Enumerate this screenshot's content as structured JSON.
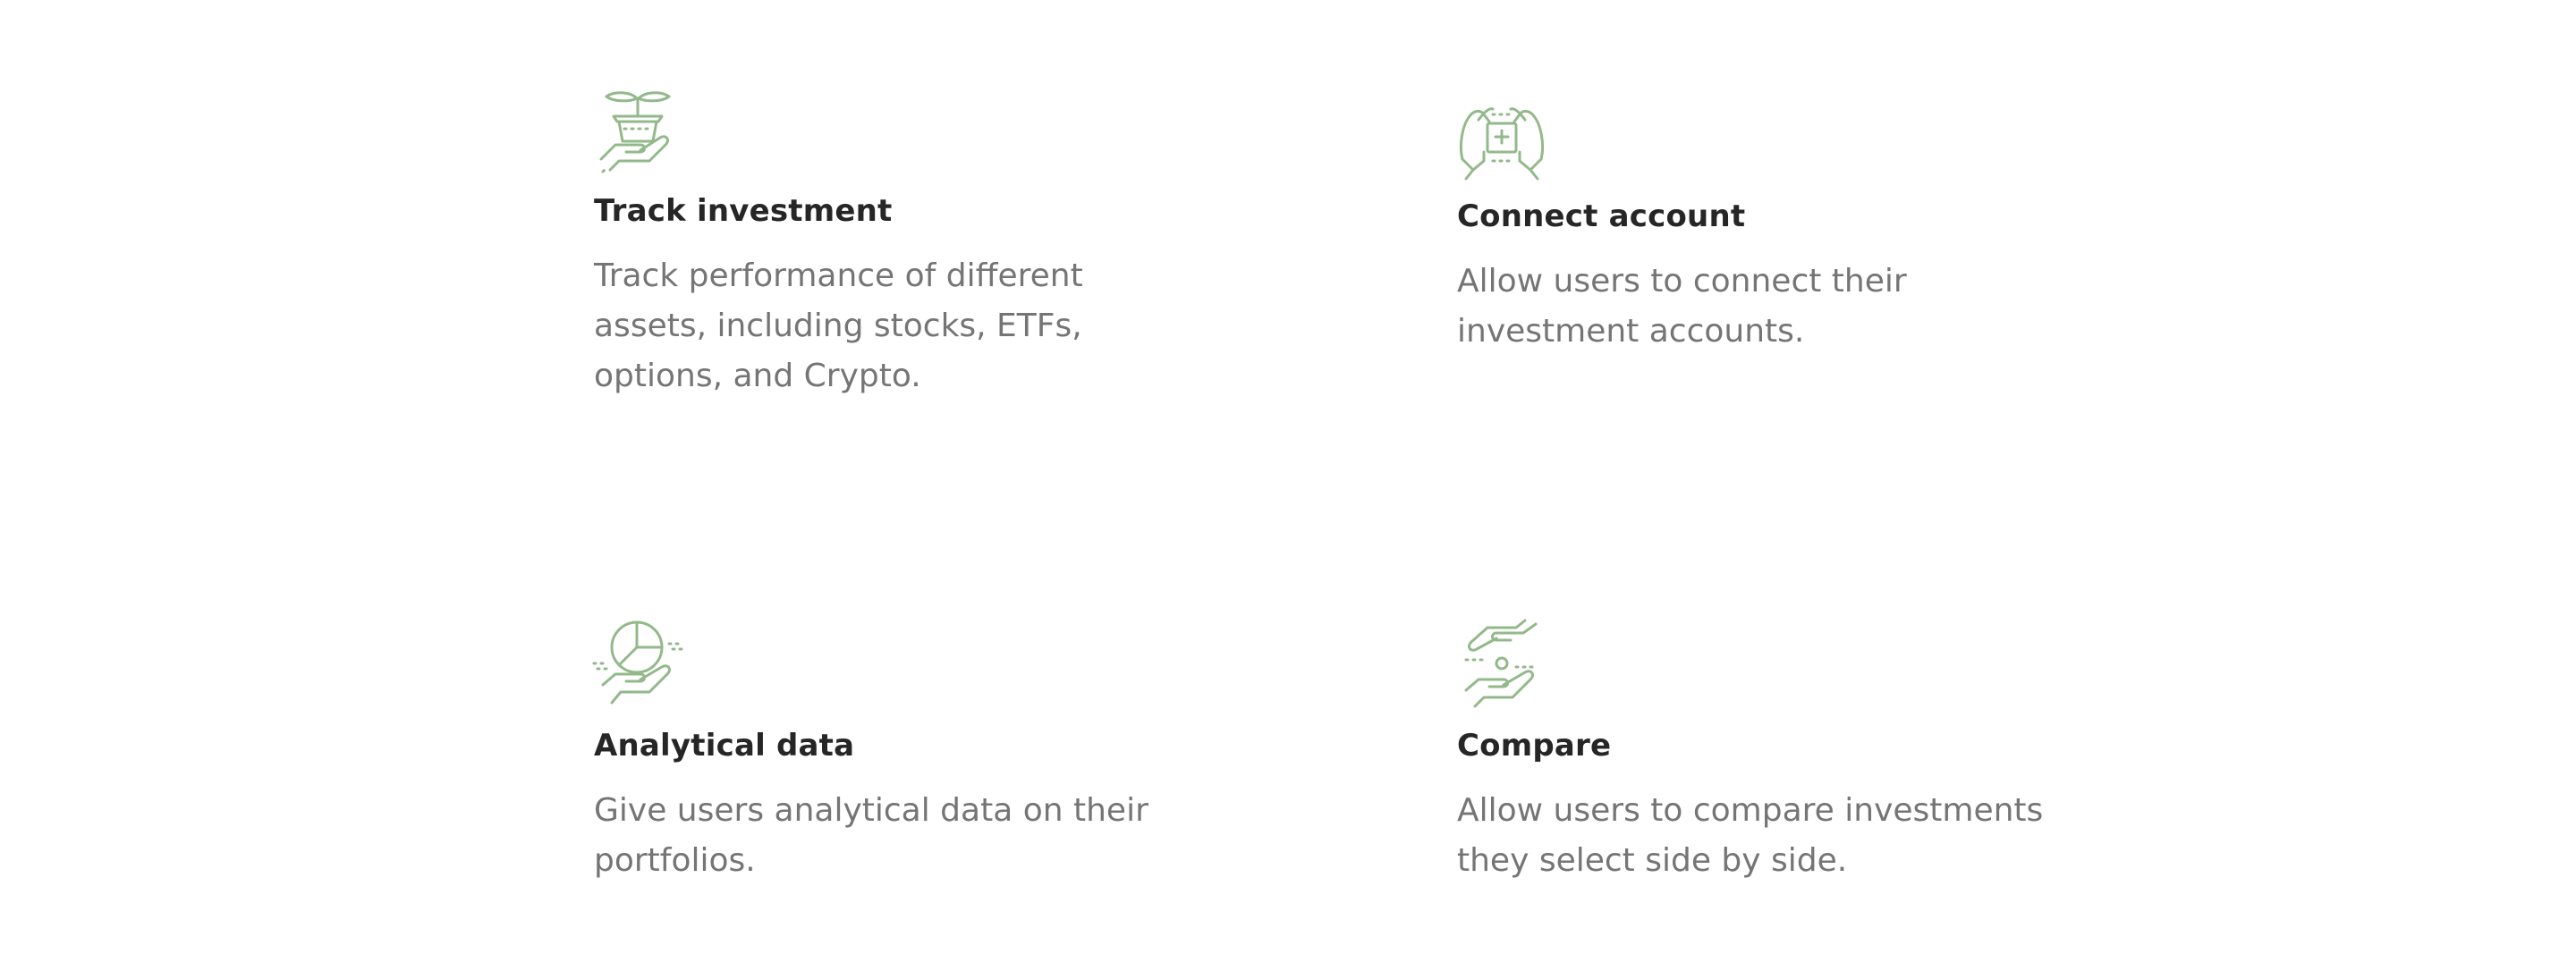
{
  "features": [
    {
      "icon": "plant-in-hand-icon",
      "title": "Track investment",
      "description": "Track performance of different assets, including stocks, ETFs, options, and Crypto."
    },
    {
      "icon": "hands-around-box-icon",
      "title": "Connect account",
      "description": "Allow users to connect their investment accounts."
    },
    {
      "icon": "pie-chart-in-hand-icon",
      "title": "Analytical data",
      "description": "Give users analytical data on their portfolios."
    },
    {
      "icon": "hands-exchange-coin-icon",
      "title": "Compare",
      "description": "Allow users to compare investments they select side by side."
    }
  ],
  "colors": {
    "icon_stroke": "#93b98b",
    "title": "#262626",
    "description": "#757575",
    "background": "#ffffff"
  }
}
